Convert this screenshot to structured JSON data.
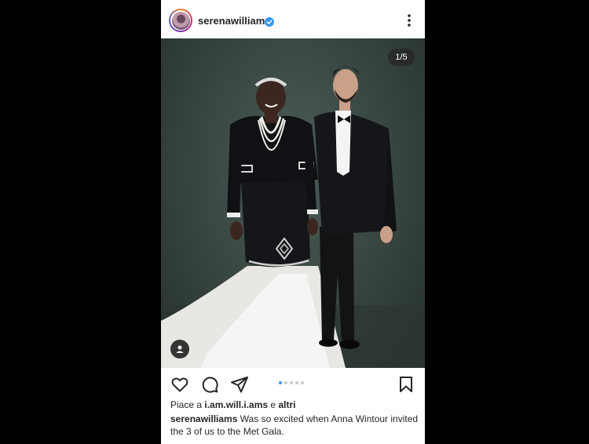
{
  "post": {
    "username": "serenawilliams",
    "image_counter": "1/5",
    "likes_prefix": "Piace a",
    "likes_user": "i.am.will.i.ams",
    "likes_joiner": "e",
    "likes_others": "altri",
    "caption_user": "serenawilliams",
    "caption_text": "Was so excited when Anna Wintour invited the 3 of us to the Met Gala."
  },
  "carousel": {
    "total": 5,
    "active_index": 0
  },
  "colors": {
    "accent": "#3897f0",
    "verified": "#3897f0",
    "text": "#262626"
  },
  "icons": [
    "verified-badge-icon",
    "more-options-icon",
    "heart-icon",
    "comment-icon",
    "share-icon",
    "bookmark-icon",
    "user-tag-icon"
  ]
}
